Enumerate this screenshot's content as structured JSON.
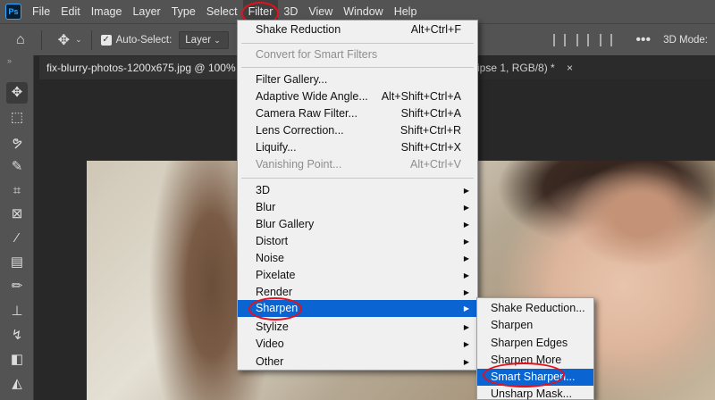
{
  "app": {
    "logo": "Ps"
  },
  "menubar": {
    "items": [
      "File",
      "Edit",
      "Image",
      "Layer",
      "Type",
      "Select",
      "Filter",
      "3D",
      "View",
      "Window",
      "Help"
    ],
    "active": "Filter"
  },
  "options": {
    "autoselect_label": "Auto-Select:",
    "autoselect_checked": true,
    "layer_value": "Layer",
    "mode_label": "3D Mode:"
  },
  "tabs": {
    "active_tab": "fix-blurry-photos-1200x675.jpg @ 100%",
    "other_tab": "ipse 1, RGB/8) *",
    "close": "×"
  },
  "tools": [
    "move-tool",
    "marquee-tool",
    "lasso-tool",
    "quick-selection-tool",
    "crop-tool",
    "frame-tool",
    "eyedropper-tool",
    "healing-brush-tool",
    "brush-tool",
    "clone-stamp-tool",
    "history-brush-tool",
    "eraser-tool",
    "paint-bucket-tool"
  ],
  "filter_menu": {
    "items": [
      {
        "label": "Shake Reduction",
        "shortcut": "Alt+Ctrl+F",
        "disabled": false
      },
      {
        "label": "Convert for Smart Filters",
        "shortcut": "",
        "disabled": true
      },
      {
        "label": "Filter Gallery...",
        "shortcut": "",
        "disabled": false
      },
      {
        "label": "Adaptive Wide Angle...",
        "shortcut": "Alt+Shift+Ctrl+A",
        "disabled": false
      },
      {
        "label": "Camera Raw Filter...",
        "shortcut": "Shift+Ctrl+A",
        "disabled": false
      },
      {
        "label": "Lens Correction...",
        "shortcut": "Shift+Ctrl+R",
        "disabled": false
      },
      {
        "label": "Liquify...",
        "shortcut": "Shift+Ctrl+X",
        "disabled": false
      },
      {
        "label": "Vanishing Point...",
        "shortcut": "Alt+Ctrl+V",
        "disabled": true
      },
      {
        "label": "3D",
        "submenu": true
      },
      {
        "label": "Blur",
        "submenu": true
      },
      {
        "label": "Blur Gallery",
        "submenu": true
      },
      {
        "label": "Distort",
        "submenu": true
      },
      {
        "label": "Noise",
        "submenu": true
      },
      {
        "label": "Pixelate",
        "submenu": true
      },
      {
        "label": "Render",
        "submenu": true
      },
      {
        "label": "Sharpen",
        "submenu": true,
        "highlighted": true
      },
      {
        "label": "Stylize",
        "submenu": true
      },
      {
        "label": "Video",
        "submenu": true
      },
      {
        "label": "Other",
        "submenu": true
      }
    ]
  },
  "sharpen_submenu": {
    "items": [
      "Shake Reduction...",
      "Sharpen",
      "Sharpen Edges",
      "Sharpen More",
      "Smart Sharpen...",
      "Unsharp Mask..."
    ],
    "highlighted": "Smart Sharpen..."
  },
  "colors": {
    "highlight": "#0a64d2",
    "annotation": "#e4101e"
  }
}
